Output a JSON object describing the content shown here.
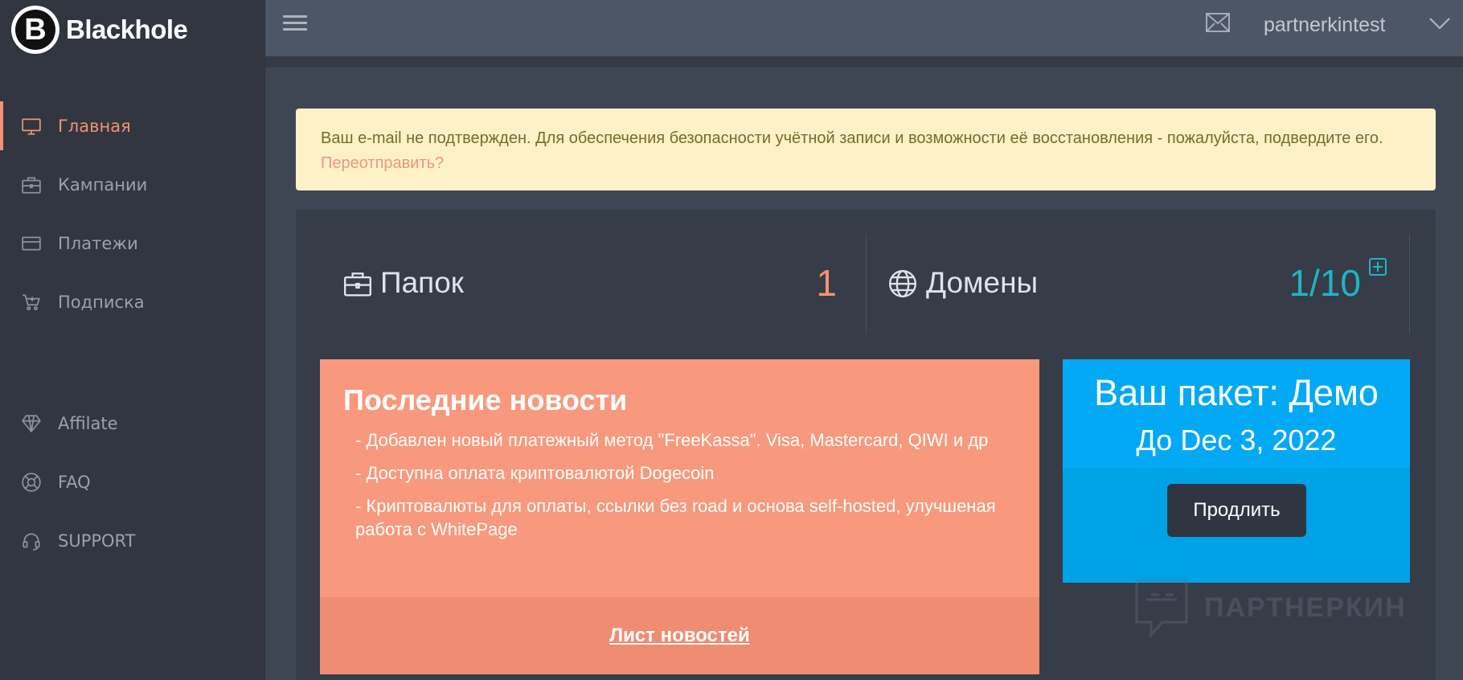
{
  "brand": {
    "letter": "B",
    "name": "Blackhole"
  },
  "sidebar": {
    "items": [
      {
        "label": "Главная",
        "icon": "monitor-icon"
      },
      {
        "label": "Кампании",
        "icon": "briefcase-icon"
      },
      {
        "label": "Платежи",
        "icon": "credit-card-icon"
      },
      {
        "label": "Подписка",
        "icon": "cart-icon"
      },
      {
        "label": "Affilate",
        "icon": "diamond-icon"
      },
      {
        "label": "FAQ",
        "icon": "lifebuoy-icon"
      },
      {
        "label": "SUPPORT",
        "icon": "headset-icon"
      }
    ],
    "active_index": 0
  },
  "header": {
    "username": "partnerkintest"
  },
  "alert": {
    "message": "Ваш e-mail не подтвержден. Для обеспечения безопасности учётной записи и возможности её восстановления - пожалуйста, подвердите его.",
    "link_label": "Переотправить?"
  },
  "stats": {
    "folders": {
      "label": "Папок",
      "value": "1"
    },
    "domains": {
      "label": "Домены",
      "value": "1/10"
    }
  },
  "news": {
    "title": "Последние новости",
    "items": [
      "- Добавлен новый платежный метод \"FreeKassa\". Visa, Mastercard, QIWI и др",
      "- Доступна оплата криптовалютой Dogecoin",
      "- Криптовалюты для оплаты, ссылки без road и основа self-hosted, улучшеная работа с WhitePage"
    ],
    "footer_link": "Лист новостей"
  },
  "package": {
    "title": "Ваш пакет: Демо",
    "until": "До Dec 3, 2022",
    "button_label": "Продлить"
  },
  "watermark": {
    "text": "ПАРТНЕРКИН"
  },
  "colors": {
    "accent": "#f39175",
    "teal": "#1fb5c4",
    "news_bg": "#f8987c",
    "package_bg": "#03a9f4",
    "alert_bg": "#fdf1c7"
  }
}
